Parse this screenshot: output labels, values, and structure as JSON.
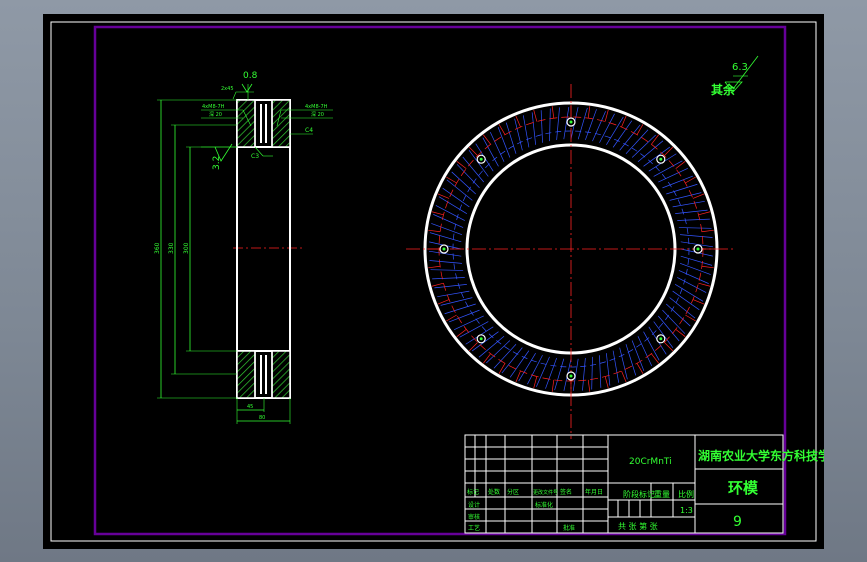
{
  "colors": {
    "background": "#000000",
    "frame": "#660099",
    "outline": "#ffffff",
    "dimension": "#33ff33",
    "centerline": "#ff2222",
    "hatch": "#3355ff",
    "teeth": "#ff2222"
  },
  "section_view": {
    "top_label": "0.8",
    "roughness_left": "3.2",
    "chamfer_label": "C3",
    "chamfer_label_right": "C4",
    "dim_vertical_1": "360",
    "dim_vertical_2": "330",
    "dim_vertical_3": "300",
    "dim_bottom_1": "45",
    "dim_bottom_2": "80",
    "callout_left": "4xM8-7H",
    "callout_left_2": "深 20",
    "callout_right": "4xM8-7H",
    "callout_right_2": "深 20",
    "top_small": "2x45"
  },
  "surface_note": {
    "value": "6.3",
    "text": "其余"
  },
  "title_block": {
    "material": "20CrMnTi",
    "school": "湖南农业大学东方科技学院",
    "part_name": "环模",
    "drawing_no": "9",
    "scale": "1:3",
    "row_labels": [
      "标记",
      "处数",
      "分区",
      "更改文件号",
      "签名",
      "年月日"
    ],
    "stage_label": "阶段标记",
    "weight_label": "重量",
    "scale_label": "比例",
    "designer_label": "设计",
    "checker_label": "审核",
    "process_label": "工艺",
    "approve_label": "批准",
    "std_label": "标准化",
    "sheets_label": "共 张 第 张"
  }
}
